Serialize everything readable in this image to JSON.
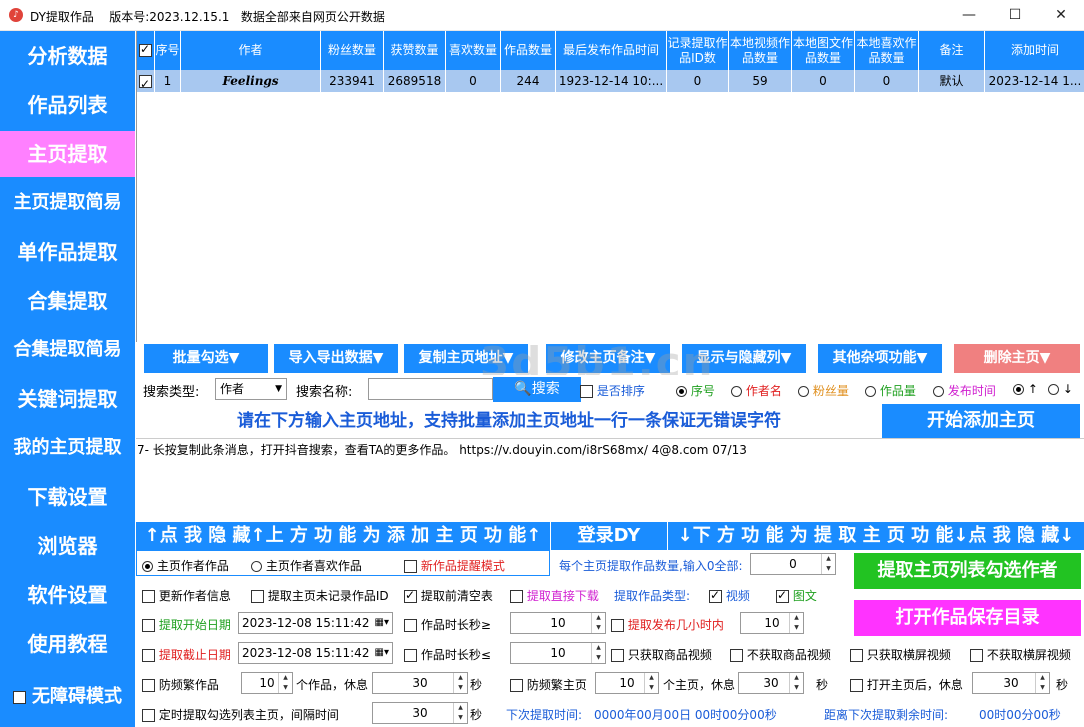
{
  "app": {
    "icon_name": "douyin-logo-icon",
    "title": "DY提取作品",
    "version": "版本号:2023.12.15.1",
    "notice": "数据全部来自网页公开数据"
  },
  "window_controls": {
    "minimize": "—",
    "maximize": "☐",
    "close": "✕"
  },
  "sidebar": {
    "items": [
      {
        "label": "分析数据"
      },
      {
        "label": "作品列表"
      },
      {
        "label": "主页提取"
      },
      {
        "label": "主页提取简易"
      },
      {
        "label": "单作品提取"
      },
      {
        "label": "合集提取"
      },
      {
        "label": "合集提取简易"
      },
      {
        "label": "关键词提取"
      },
      {
        "label": "我的主页提取"
      },
      {
        "label": "下载设置"
      },
      {
        "label": "浏览器"
      },
      {
        "label": "软件设置"
      },
      {
        "label": "使用教程"
      }
    ],
    "accessible_mode": "无障碍模式",
    "active_index": 2
  },
  "table": {
    "headers": [
      "序号",
      "作者",
      "粉丝数量",
      "获赞数量",
      "喜欢数量",
      "作品数量",
      "最后发布作品时间",
      "记录提取作品ID数",
      "本地视频作品数量",
      "本地图文作品数量",
      "本地喜欢作品数量",
      "备注",
      "添加时间"
    ],
    "rows": [
      {
        "checked": true,
        "cells": [
          "1",
          "Feelings",
          "233941",
          "2689518",
          "0",
          "244",
          "1923-12-14 10:...",
          "0",
          "59",
          "0",
          "0",
          "默认",
          "2023-12-14 1..."
        ]
      }
    ]
  },
  "toolbar": {
    "buttons": [
      "批量勾选▼",
      "导入导出数据▼",
      "复制主页地址▼",
      "修改主页备注▼",
      "显示与隐藏列▼",
      "其他杂项功能▼",
      "删除主页▼"
    ]
  },
  "search": {
    "type_label": "搜索类型:",
    "type_value": "作者",
    "name_label": "搜索名称:",
    "name_value": "",
    "button": "搜索",
    "sort_label": "是否排序",
    "sort_options": [
      "序号",
      "作者名",
      "粉丝量",
      "作品量",
      "发布时间"
    ],
    "order_options": [
      "↑",
      "↓"
    ]
  },
  "banner": {
    "text": "请在下方输入主页地址，支持批量添加主页地址一行一条保证无错误字符",
    "add_button": "开始添加主页"
  },
  "input_text": "7- 长按复制此条消息，打开抖音搜索，查看TA的更多作品。 https://v.douyin.com/i8rS68mx/ 4@8.com 07/13",
  "watermark": "3d5b1.cn",
  "hidebar": {
    "left": "↑点 我 隐 藏↑上 方 功 能 为 添 加 主 页 功 能↑",
    "center": "登录DY",
    "right": "↓下 方 功 能 为 提 取 主 页 功 能↓点 我 隐 藏↓"
  },
  "options": {
    "radio_home": "主页作者作品",
    "radio_likes": "主页作者喜欢作品",
    "new_remind": "新作品提醒模式",
    "per_home_label": "每个主页提取作品数量,输入0全部:",
    "per_home_value": "0",
    "extract_btn": "提取主页列表勾选作者",
    "open_dir_btn": "打开作品保存目录",
    "update_author": "更新作者信息",
    "unrecorded": "提取主页未记录作品ID",
    "clear_before": "提取前清空表",
    "direct_download": "提取直接下载",
    "type_label": "提取作品类型:",
    "type_video": "视频",
    "type_image": "图文",
    "start_date_label": "提取开始日期",
    "start_date": "2023-12-08 15:11:42",
    "duration_ge": "作品时长秒≥",
    "duration_ge_value": "10",
    "hours_label": "提取发布几小时内",
    "hours_value": "10",
    "end_date_label": "提取截止日期",
    "end_date": "2023-12-08 15:11:42",
    "duration_le": "作品时长秒≤",
    "duration_le_value": "10",
    "only_goods": "只获取商品视频",
    "no_goods": "不获取商品视频",
    "only_landscape": "只获取横屏视频",
    "no_landscape": "不获取横屏视频",
    "anti_works": "防频繁作品",
    "anti_works_count": "10",
    "works_rest": "个作品，休息",
    "anti_works_sec": "30",
    "sec": "秒",
    "anti_home": "防频繁主页",
    "anti_home_count": "10",
    "home_rest": "个主页，休息",
    "anti_home_sec": "30",
    "open_home": "打开主页后，休息",
    "open_home_sec": "30",
    "timer": "定时提取勾选列表主页，间隔时间",
    "timer_value": "30",
    "next_time_label": "下次提取时间:",
    "next_time": "0000年00月00日 00时00分00秒",
    "remain_label": "距离下次提取剩余时间:",
    "remain": "00时00分00秒"
  }
}
